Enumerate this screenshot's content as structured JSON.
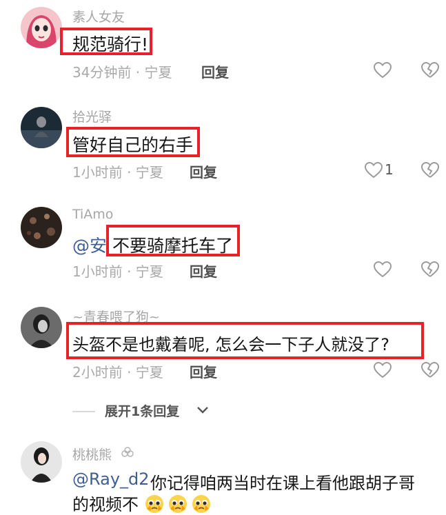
{
  "comments": [
    {
      "username": "素人女友",
      "text": "规范骑行!",
      "time": "34分钟前 · 宁夏",
      "reply": "回复",
      "likes": ""
    },
    {
      "username": "拾光驿",
      "text": "管好自己的右手",
      "time": "1小时前 · 宁夏",
      "reply": "回复",
      "likes": "1"
    },
    {
      "username": "TiAmo",
      "mention": "@安",
      "text": "不要骑摩托车了",
      "time": "1小时前 · 宁夏",
      "reply": "回复",
      "likes": ""
    },
    {
      "username": "~青春喂了狗~",
      "text": "头盔不是也戴着呢, 怎么会一下子人就没了?",
      "time": "2小时前 · 宁夏",
      "reply": "回复",
      "likes": ""
    },
    {
      "username": "桃桃熊",
      "mention": "@Ray_d2",
      "text": "你记得咱两当时在课上看他跟胡子哥",
      "text2": "的视频不"
    }
  ],
  "expand": {
    "label": "展开1条回复"
  },
  "icons": {
    "like": "heart-outline-icon",
    "dislike": "broken-heart-icon",
    "expand": "chevron-down-icon",
    "badge": "flower-badge-icon",
    "emoji": "pleading-face-emoji"
  },
  "colors": {
    "highlight": "#e8202a",
    "mention": "#3f5e95",
    "meta": "#a9a9a9",
    "username": "#a6a6a6"
  }
}
